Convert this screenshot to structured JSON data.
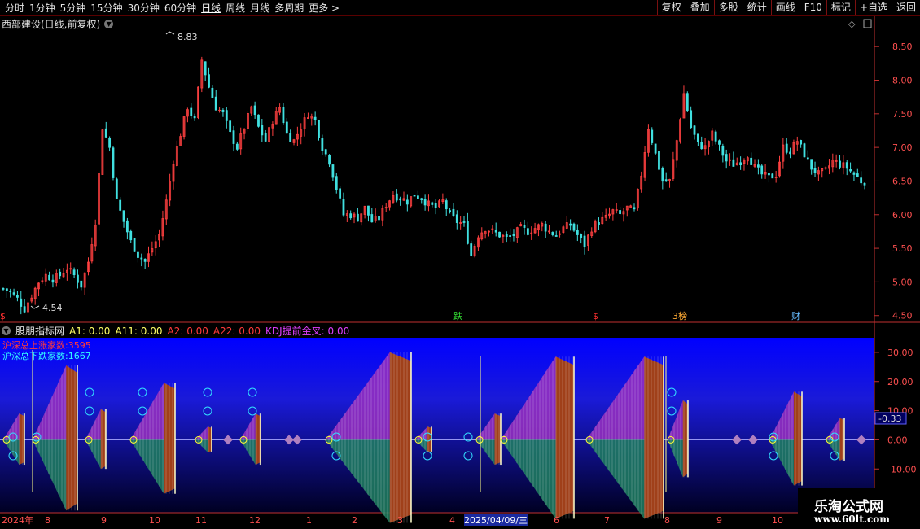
{
  "toolbar": {
    "periods": [
      "分时",
      "1分钟",
      "5分钟",
      "15分钟",
      "30分钟",
      "60分钟",
      "日线",
      "周线",
      "月线",
      "多周期",
      "更多"
    ],
    "active_period": "日线",
    "more_arrow": ">",
    "right_buttons": [
      "复权",
      "叠加",
      "多股",
      "统计",
      "画线",
      "F10",
      "标记",
      "+自选",
      "返回"
    ]
  },
  "stock": {
    "title": "西部建设(日线,前复权)",
    "high_label": "8.83",
    "low_label": "4.54"
  },
  "events": [
    {
      "label": "$",
      "color": "#ff3030"
    },
    {
      "label": "跌",
      "color": "#33dd33"
    },
    {
      "label": "$",
      "color": "#ff3030"
    },
    {
      "label": "3榜",
      "color": "#ffaa33"
    },
    {
      "label": "财",
      "color": "#66bbff"
    }
  ],
  "price_axis": [
    "8.50",
    "8.00",
    "7.50",
    "7.00",
    "6.50",
    "6.00",
    "5.50",
    "5.00",
    "4.50"
  ],
  "indicator": {
    "name": "股朋指标网",
    "a1": "A1: 0.00",
    "a11": "A11: 0.00",
    "a2": "A2: 0.00",
    "a22": "A22: 0.00",
    "kdj": "KDJ提前金叉: 0.00",
    "up_count": "沪深总上涨家数:3595",
    "down_count": "沪深总下跌家数:1667",
    "current_value": "-0.33"
  },
  "ind_axis": [
    "30.00",
    "20.00",
    "10.00",
    "0.00",
    "-10.00",
    "-20.00"
  ],
  "date_axis": [
    "2024年",
    "8",
    "9",
    "10",
    "11",
    "12",
    "1",
    "2",
    "3",
    "4",
    "2025/04/09/三",
    "6",
    "7",
    "8",
    "9",
    "10"
  ],
  "logo": {
    "line1": "乐淘公式网",
    "line2": "www.60lt.com"
  },
  "colors": {
    "up": "#ff4040",
    "down": "#40e0e0",
    "axis": "#c03030",
    "ind_bg_top": "#0000ff",
    "ind_bg_bottom": "#000022"
  },
  "chart_data": {
    "type": "candlestick",
    "title": "西部建设(日线,前复权)",
    "ylim": [
      4.4,
      8.95
    ],
    "y_ticks": [
      8.5,
      8.0,
      7.5,
      7.0,
      6.5,
      6.0,
      5.5,
      5.0,
      4.5
    ],
    "x_labels": [
      "2024年",
      "8",
      "9",
      "10",
      "11",
      "12",
      "1",
      "2",
      "3",
      "4",
      "2025/04/09/三",
      "6",
      "7",
      "8",
      "9",
      "10"
    ],
    "close_trend": [
      4.9,
      4.85,
      4.75,
      4.6,
      4.8,
      5.0,
      5.1,
      5.05,
      5.1,
      5.2,
      5.1,
      4.95,
      5.3,
      5.9,
      7.3,
      7.0,
      6.2,
      5.9,
      5.6,
      5.4,
      5.3,
      5.5,
      5.7,
      6.2,
      6.8,
      7.2,
      7.6,
      7.4,
      8.3,
      7.9,
      7.6,
      7.5,
      7.2,
      7.0,
      7.3,
      7.6,
      7.3,
      7.1,
      7.4,
      7.6,
      7.2,
      7.1,
      7.3,
      7.5,
      7.4,
      7.0,
      6.8,
      6.4,
      6.0,
      6.0,
      5.95,
      6.1,
      5.9,
      5.95,
      6.15,
      6.3,
      6.25,
      6.2,
      6.3,
      6.25,
      6.15,
      6.1,
      6.2,
      6.0,
      5.9,
      5.85,
      5.4,
      5.7,
      5.8,
      5.75,
      5.7,
      5.65,
      5.7,
      5.8,
      5.75,
      5.8,
      5.85,
      5.75,
      5.7,
      5.8,
      5.85,
      5.7,
      5.55,
      5.8,
      5.9,
      5.95,
      6.05,
      6.0,
      6.1,
      6.05,
      6.6,
      7.3,
      6.9,
      6.5,
      6.5,
      7.1,
      7.8,
      7.3,
      7.05,
      7.0,
      7.2,
      7.0,
      6.8,
      6.75,
      6.8,
      6.9,
      6.7,
      6.6,
      6.55,
      6.6,
      7.0,
      6.95,
      7.1,
      6.9,
      6.7,
      6.6,
      6.65,
      6.8,
      6.75,
      6.7,
      6.6,
      6.5
    ],
    "high": 8.83,
    "low": 4.54,
    "indicator_ylim": [
      -25,
      35
    ],
    "indicator_ticks": [
      30,
      20,
      10,
      0,
      -10,
      -20
    ],
    "indicator_current": -0.33
  }
}
